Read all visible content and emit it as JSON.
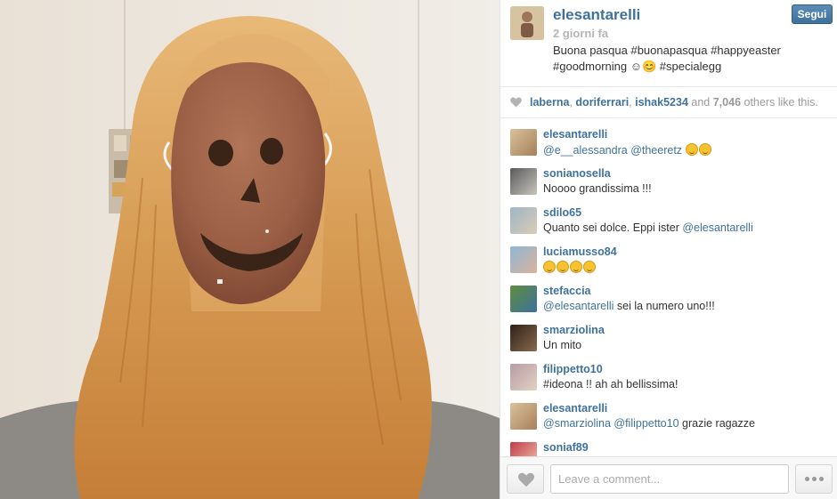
{
  "post": {
    "owner": "elesantarelli",
    "time": "2 giorni fa",
    "caption": "Buona pasqua #buonapasqua #happyeaster #goodmorning ☺😊 #specialegg",
    "follow_label": "Segui",
    "photo_alt": "selfie with chocolate egg mask"
  },
  "likes": {
    "users": [
      "laberna",
      "doriferrari",
      "ishak5234"
    ],
    "and_text": "and",
    "count": "7,046",
    "suffix": "others like this."
  },
  "comments": [
    {
      "user": "elesantarelli",
      "parts": [
        {
          "t": "@e__alessandra",
          "m": true
        },
        {
          "t": " "
        },
        {
          "t": "@theeretz",
          "m": true
        },
        {
          "t": " "
        }
      ],
      "emoji": 2,
      "avatar": [
        "#d9c19b",
        "#a7805a"
      ]
    },
    {
      "user": "sonianosella",
      "parts": [
        {
          "t": "Noooo grandissima !!!"
        }
      ],
      "emoji": 0,
      "avatar": [
        "#5a5a5a",
        "#c8c4bd"
      ]
    },
    {
      "user": "sdilo65",
      "parts": [
        {
          "t": "Quanto sei dolce. Eppi ister "
        },
        {
          "t": "@elesantarelli",
          "m": true
        }
      ],
      "emoji": 0,
      "avatar": [
        "#9fb4c9",
        "#d8cdb4"
      ]
    },
    {
      "user": "luciamusso84",
      "parts": [
        {
          "t": ""
        }
      ],
      "emoji": 4,
      "avatar": [
        "#8fb6d6",
        "#d9b49a"
      ]
    },
    {
      "user": "stefaccia",
      "parts": [
        {
          "t": "@elesantarelli",
          "m": true
        },
        {
          "t": " sei la numero uno!!!"
        }
      ],
      "emoji": 0,
      "avatar": [
        "#5f8f3a",
        "#3d6fa0"
      ]
    },
    {
      "user": "smarziolina",
      "parts": [
        {
          "t": "Un mito"
        }
      ],
      "emoji": 0,
      "avatar": [
        "#2e2218",
        "#8a6a4d"
      ]
    },
    {
      "user": "filippetto10",
      "parts": [
        {
          "t": "#ideona !! ah ah bellissima!"
        }
      ],
      "emoji": 0,
      "avatar": [
        "#b99aa8",
        "#e1d2c0"
      ]
    },
    {
      "user": "elesantarelli",
      "parts": [
        {
          "t": "@smarziolina",
          "m": true
        },
        {
          "t": " "
        },
        {
          "t": "@filippetto10",
          "m": true
        },
        {
          "t": " grazie ragazze"
        }
      ],
      "emoji": 0,
      "avatar": [
        "#d9c19b",
        "#a7805a"
      ]
    },
    {
      "user": "soniaf89",
      "parts": [
        {
          "t": ""
        }
      ],
      "emoji": 0,
      "avatar": [
        "#c23a4a",
        "#f0c8b0"
      ]
    }
  ],
  "footer": {
    "comment_placeholder": "Leave a comment...",
    "like_icon": "heart-icon",
    "more_icon": "ellipsis-icon"
  },
  "colors": {
    "link": "#3f729b",
    "follow_button": "#3f729b",
    "muted": "#b5b5b5"
  }
}
